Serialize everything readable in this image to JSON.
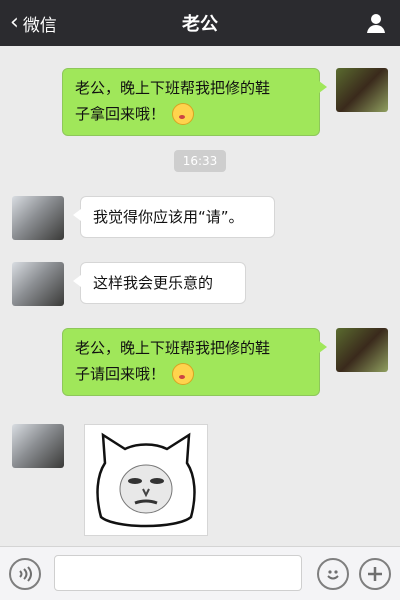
{
  "header": {
    "back_label": "微信",
    "title": "老公"
  },
  "messages": [
    {
      "side": "right",
      "type": "text",
      "text_line1": "老公，晚上下班帮我把修的鞋",
      "text_line2": "子拿回来哦！"
    },
    {
      "type": "time",
      "text": "16:33"
    },
    {
      "side": "left",
      "type": "text",
      "text": "我觉得你应该用“请”。"
    },
    {
      "side": "left",
      "type": "text",
      "text": "这样我会更乐意的"
    },
    {
      "side": "right",
      "type": "text",
      "text_line1": "老公，晚上下班帮我把修的鞋",
      "text_line2": "子请回来哦！"
    },
    {
      "side": "left",
      "type": "sticker",
      "sticker": "cat-face-meme-sticker"
    }
  ],
  "icons": {
    "back": "chevron-left-icon",
    "user": "user-icon",
    "voice": "voice-icon",
    "emoji": "emoji-icon",
    "plus": "plus-icon"
  },
  "colors": {
    "header_bg": "#2b2b2f",
    "chat_bg": "#ebebeb",
    "bubble_green": "#a0e75a",
    "bubble_white": "#ffffff"
  }
}
